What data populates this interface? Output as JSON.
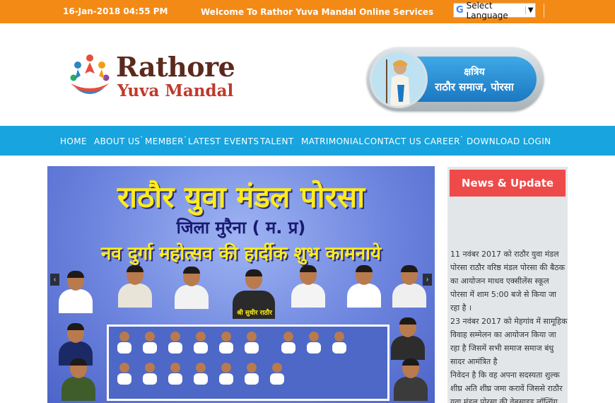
{
  "topbar": {
    "datetime": "16-Jan-2018 04:55 PM",
    "welcome": "Welcome To Rathor Yuva Mandal Online Services",
    "language_select": {
      "label": "Select Language",
      "icon": "google-g-icon",
      "arrow": "▼"
    }
  },
  "logo": {
    "line1": "Rathore",
    "line2": "Yuva Mandal"
  },
  "badge": {
    "line1": "क्षत्रिय",
    "line2": "राठौर समाज, पोरसा"
  },
  "nav": {
    "items": [
      {
        "label": "HOME"
      },
      {
        "label": "ABOUT US",
        "caret": "˅"
      },
      {
        "label": "MEMBER",
        "caret": "˅"
      },
      {
        "label": "LATEST EVENTS"
      },
      {
        "label": "TALENT"
      },
      {
        "label": "MATRIMONIAL"
      },
      {
        "label": "CONTACT US"
      },
      {
        "label": "CAREER",
        "caret": "˅"
      },
      {
        "label": "DOWNLOAD"
      },
      {
        "label": "LOGIN"
      }
    ]
  },
  "slider": {
    "heading": "राठौर युवा मंडल पोरसा",
    "district": "जिला मुरैना ( म. प्र)",
    "greeting": "नव दुर्गा महोत्सव की हार्दीक शुभ कामनाये",
    "prev_icon": "‹",
    "next_icon": "›",
    "caption_center": "श्री सुधीर राठौर"
  },
  "news": {
    "title": "News & Update",
    "items": [
      "11 नवंबर 2017 को राठौर युवा मंडल पोरसा राठौर वरिष्ठ मंडल पोरसा की बैठक का आयोजन माधव एक्सीलेंस स्कूल पोरसा में शाम 5:00 बजे से किया जा रहा है ।",
      "23 नवंबर 2017 को मेहगांव में सामूहिक विवाह सम्मेलन का आयोजन किया जा रहा है जिसमें सभी समाज समाज बंधु सादर आमंत्रित है",
      "निवेदन है कि वह अपना सदस्यता शुल्क शीघ्र अति शीघ्र जमा करावें जिससे राठौर युवा मंडल पोरसा की वेबसाइड लॉन्चिंग का प्रोग्राम बनाया"
    ]
  },
  "colors": {
    "topbar": "#f38a16",
    "nav": "#17a4df",
    "news_title": "#ee4a4a",
    "brand_dark": "#5b2a1d",
    "brand_red": "#c0392b"
  }
}
